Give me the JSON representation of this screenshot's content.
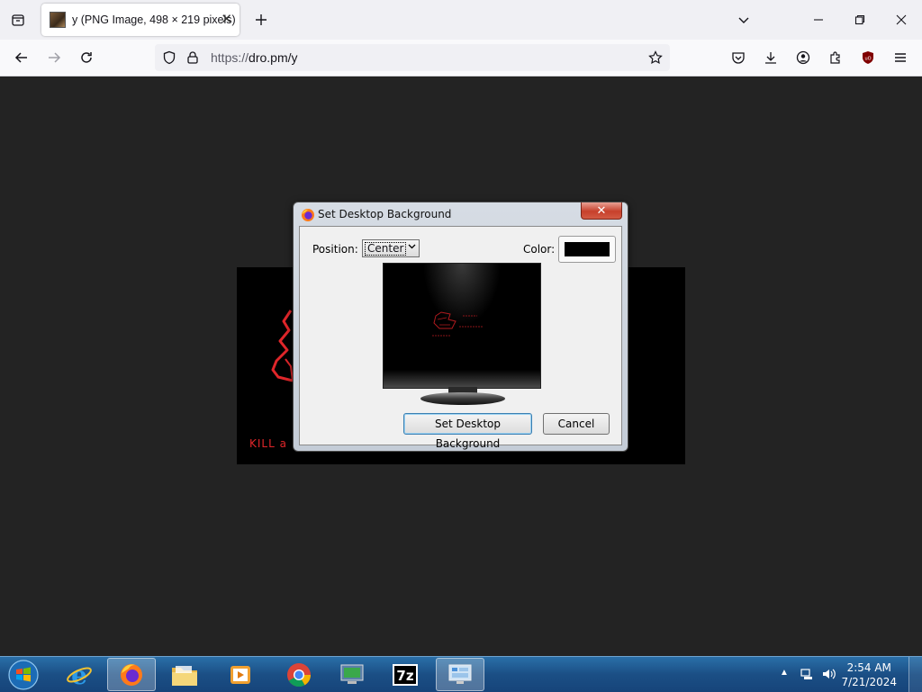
{
  "browser": {
    "tab": {
      "title": "y (PNG Image, 498 × 219 pixels)"
    },
    "url": {
      "prefix": "https://",
      "host": "dro.pm/y"
    }
  },
  "page_image": {
    "caption_fragment": "KILL a"
  },
  "dialog": {
    "title": "Set Desktop Background",
    "position_label": "Position:",
    "position_value": "Center",
    "color_label": "Color:",
    "color_value": "#000000",
    "set_button": "Set Desktop Background",
    "cancel_button": "Cancel"
  },
  "taskbar": {
    "apps": [
      "start",
      "internet-explorer",
      "firefox",
      "file-explorer",
      "media-player",
      "chrome",
      "remote-desktop",
      "7zip",
      "control-panel"
    ],
    "clock_time": "2:54 AM",
    "clock_date": "7/21/2024"
  }
}
